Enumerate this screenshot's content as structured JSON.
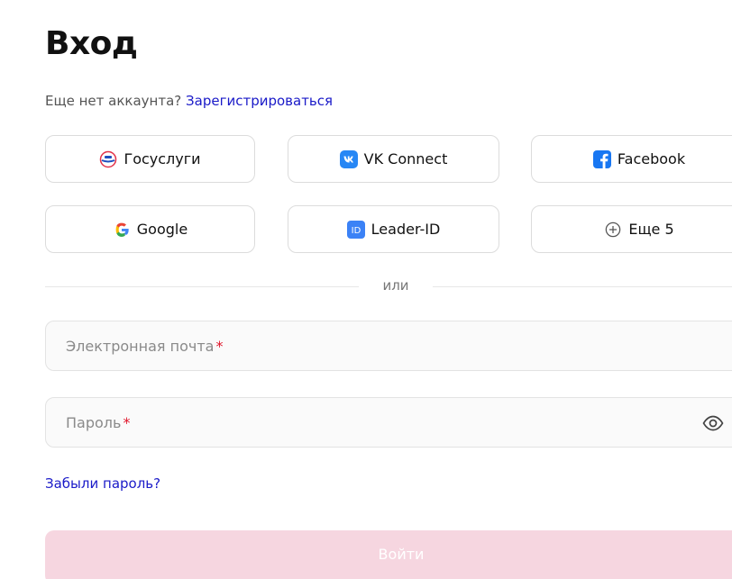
{
  "header": {
    "title": "Вход"
  },
  "signup": {
    "prompt": "Еще нет аккаунта?",
    "link_label": "Зарегистрироваться"
  },
  "social_login": {
    "buttons": [
      {
        "label": "Госуслуги",
        "icon": "gosuslugi-icon"
      },
      {
        "label": "VK Connect",
        "icon": "vk-icon"
      },
      {
        "label": "Facebook",
        "icon": "facebook-icon"
      },
      {
        "label": "Google",
        "icon": "google-icon"
      },
      {
        "label": "Leader-ID",
        "icon": "leader-id-icon"
      },
      {
        "label": "Еще 5",
        "icon": "plus-circle-icon"
      }
    ]
  },
  "divider": {
    "label": "или"
  },
  "form": {
    "email": {
      "placeholder": "Электронная почта",
      "required_mark": "*",
      "value": ""
    },
    "password": {
      "placeholder": "Пароль",
      "required_mark": "*",
      "value": "",
      "toggle_icon": "eye-icon"
    },
    "forgot_password_label": "Забыли пароль?",
    "submit_label": "Войти"
  },
  "colors": {
    "link": "#1a1ac8",
    "required": "#e0162b",
    "submit_disabled_bg": "#f6d6e0",
    "vk": "#2787f5",
    "facebook": "#1877f2",
    "leader_id": "#3b82f6"
  }
}
